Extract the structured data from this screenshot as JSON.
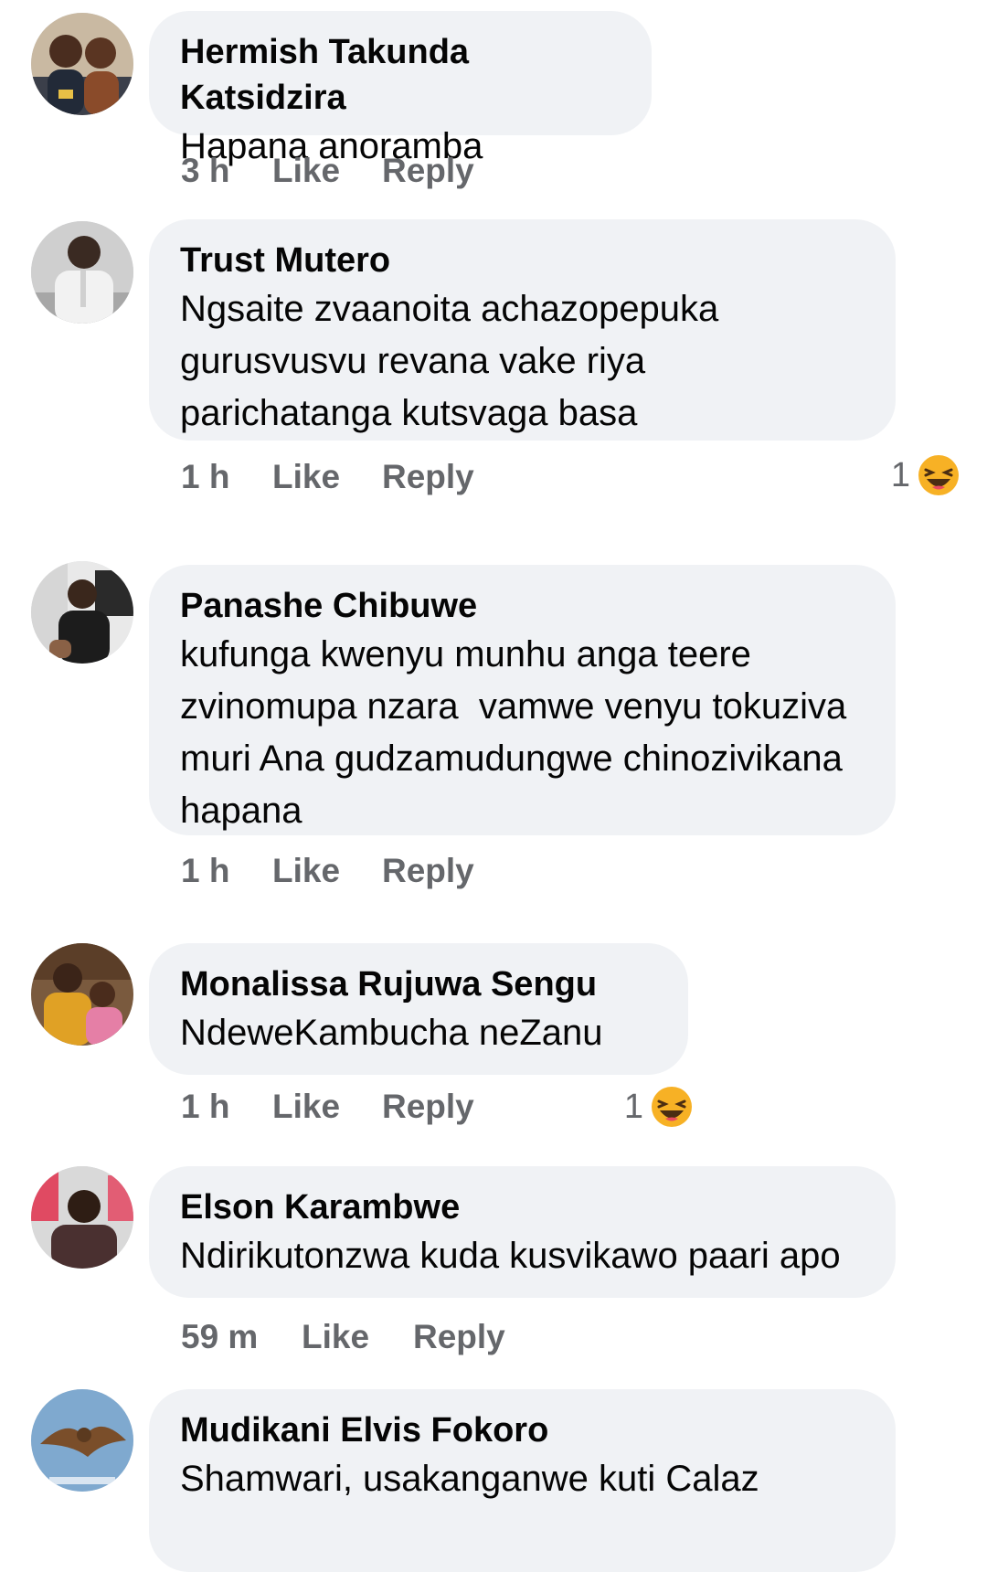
{
  "comments": [
    {
      "author": "Hermish Takunda Katsidzira",
      "text": "Hapana anoramba",
      "time": "3 h",
      "like_label": "Like",
      "reply_label": "Reply"
    },
    {
      "author": "Trust Mutero",
      "text": "Ngsaite zvaanoita achazopepuka\ngurusvusvu revana vake riya\nparichatanga kutsvaga basa",
      "time": "1 h",
      "like_label": "Like",
      "reply_label": "Reply",
      "reaction_count": "1",
      "reaction_icon": "laughing-emoji-icon"
    },
    {
      "author": "Panashe Chibuwe",
      "text": "kufunga kwenyu munhu anga teere\nzvinomupa nzara  vamwe venyu tokuziva\nmuri Ana gudzamudungwe chinozivikana\nhapana",
      "time": "1 h",
      "like_label": "Like",
      "reply_label": "Reply"
    },
    {
      "author": "Monalissa Rujuwa Sengu",
      "text": "NdeweKambucha neZanu",
      "time": "1 h",
      "like_label": "Like",
      "reply_label": "Reply",
      "reaction_count": "1",
      "reaction_icon": "laughing-emoji-icon"
    },
    {
      "author": "Elson Karambwe",
      "text": "Ndirikutonzwa kuda kusvikawo paari apo",
      "time": "59 m",
      "like_label": "Like",
      "reply_label": "Reply"
    },
    {
      "author": "Mudikani Elvis Fokoro",
      "text": "Shamwari, usakanganwe kuti Calaz"
    }
  ],
  "colors": {
    "bubble": "#f0f2f5",
    "meta_text": "#65676b",
    "name_text": "#050505",
    "emoji_face": "#f7b125"
  }
}
